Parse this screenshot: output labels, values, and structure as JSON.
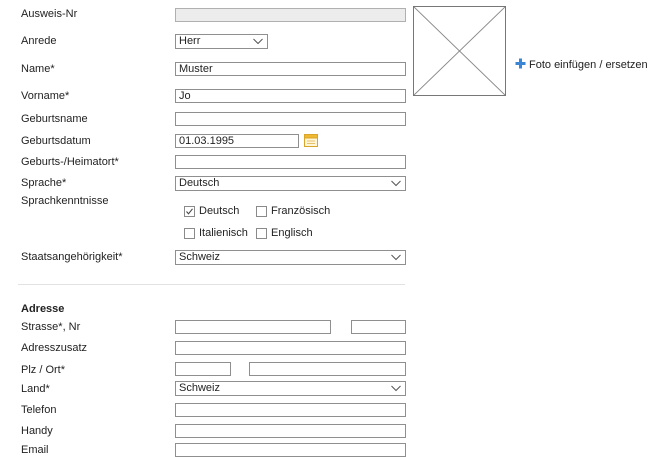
{
  "person": {
    "ausweis_label": "Ausweis-Nr",
    "ausweis_value": "",
    "anrede_label": "Anrede",
    "anrede_value": "Herr",
    "name_label": "Name*",
    "name_value": "Muster",
    "vorname_label": "Vorname*",
    "vorname_value": "Jo",
    "geburtsname_label": "Geburtsname",
    "geburtsname_value": "",
    "geburtsdatum_label": "Geburtsdatum",
    "geburtsdatum_value": "01.03.1995",
    "heimatort_label": "Geburts-/Heimatort*",
    "heimatort_value": "",
    "sprache_label": "Sprache*",
    "sprache_value": "Deutsch",
    "sprachkenntnisse_label": "Sprachkenntnisse",
    "languages": [
      {
        "label": "Deutsch",
        "checked": true
      },
      {
        "label": "Französisch",
        "checked": false
      },
      {
        "label": "Italienisch",
        "checked": false
      },
      {
        "label": "Englisch",
        "checked": false
      }
    ],
    "staat_label": "Staatsangehörigkeit*",
    "staat_value": "Schweiz"
  },
  "photo": {
    "button_label": "Foto einfügen / ersetzen",
    "placeholder_icon": "empty-image-placeholder",
    "button_icon": "plus-icon",
    "accent_color": "#3a86d4"
  },
  "address": {
    "section_title": "Adresse",
    "strasse_label": "Strasse*, Nr",
    "strasse_value": "",
    "nr_value": "",
    "zusatz_label": "Adresszusatz",
    "zusatz_value": "",
    "plz_label": "Plz / Ort*",
    "plz_value": "",
    "ort_value": "",
    "land_label": "Land*",
    "land_value": "Schweiz",
    "telefon_label": "Telefon",
    "telefon_value": "",
    "handy_label": "Handy",
    "handy_value": "",
    "email_label": "Email",
    "email_value": ""
  }
}
